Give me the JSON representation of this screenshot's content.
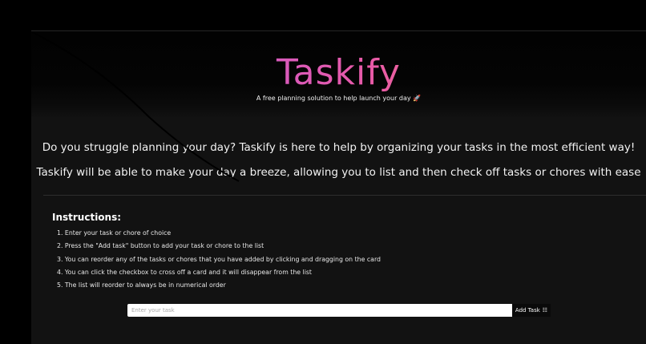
{
  "header": {
    "title": "Taskify",
    "subtitle": "A free planning solution to help launch your day 🚀"
  },
  "intro": {
    "line1": "Do you struggle planning your day? Taskify is here to help by organizing your tasks in the most efficient way!",
    "line2": "Taskify will be able to make your day a breeze, allowing you to list and then check off tasks or chores with ease"
  },
  "instructions": {
    "heading": "Instructions:",
    "items": [
      "1. Enter your task or chore of choice",
      "2. Press the \"Add task\" button to add your task or chore to the list",
      "3. You can reorder any of the tasks or chores that you have added by clicking and dragging on the card",
      "4. You can click the checkbox to cross off a card and it will disappear from the list",
      "5. The list will reorder to always be in numerical order"
    ]
  },
  "task_form": {
    "placeholder": "Enter your task",
    "value": "",
    "add_label": "Add Task",
    "add_icon": "list-icon"
  },
  "colors": {
    "title_gradient_start": "#b05cf2",
    "title_gradient_mid": "#e85aa8",
    "title_gradient_end": "#ff8a5b",
    "page_background": "#121212"
  }
}
